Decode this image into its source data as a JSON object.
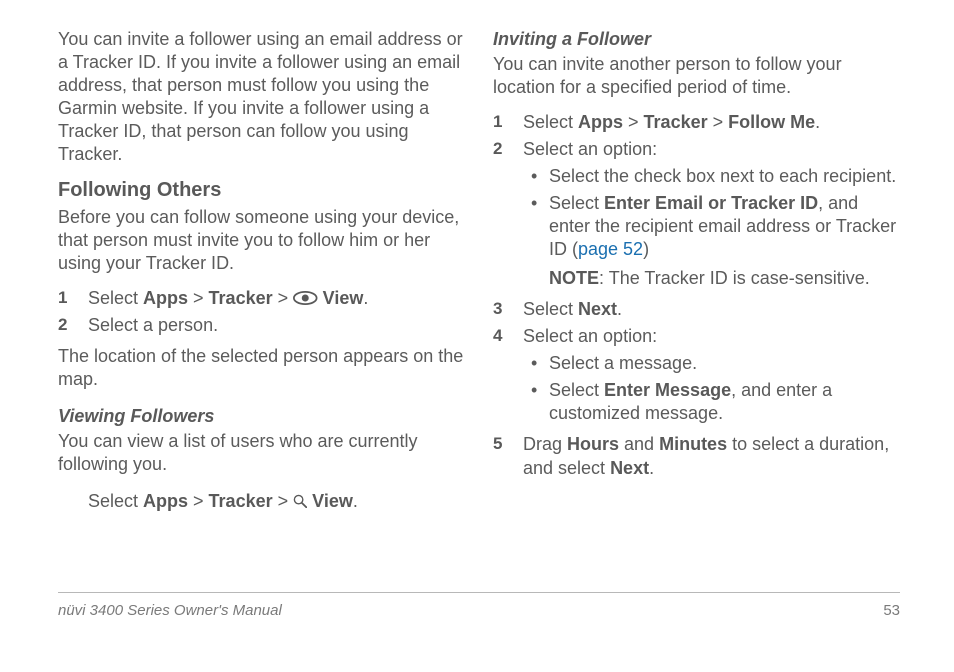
{
  "col1": {
    "intro": "You can invite a follower using an email address or a Tracker ID. If you invite a follower using an email address, that person must follow you using the Garmin website. If you invite a follower using a Tracker ID, that person can follow you using Tracker.",
    "h2": "Following Others",
    "p1": "Before you can follow someone using your device, that person must invite you to follow him or her using your Tracker ID.",
    "step1_a": "Select ",
    "apps": "Apps",
    "gt": " > ",
    "tracker": "Tracker",
    "view": "View",
    "period": ".",
    "step2": "Select a person.",
    "after": "The location of the selected person appears on the map.",
    "h3": "Viewing Followers",
    "p2": "You can view a list of users who are currently following you.",
    "vf_a": "Select "
  },
  "col2": {
    "h3": "Inviting a Follower",
    "intro": "You can invite another person to follow your location for a specified period of time.",
    "s1_a": "Select ",
    "apps": "Apps",
    "gt": " > ",
    "tracker": "Tracker",
    "followme": "Follow Me",
    "period": ".",
    "s2": "Select an option:",
    "b1": "Select the check box next to each recipient.",
    "b2_a": "Select ",
    "b2_b": "Enter Email or Tracker ID",
    "b2_c": ", and enter the recipient email address or Tracker ID (",
    "link": "page 52",
    "b2_d": ")",
    "note_a": "NOTE",
    "note_b": ": The Tracker ID is case-sensitive.",
    "s3_a": "Select ",
    "next": "Next",
    "s4": "Select an option:",
    "b3": "Select a message.",
    "b4_a": "Select ",
    "b4_b": "Enter Message",
    "b4_c": ", and enter a customized message.",
    "s5_a": "Drag ",
    "hours": "Hours",
    "s5_b": " and ",
    "minutes": "Minutes",
    "s5_c": " to select a duration, and select "
  },
  "footer": {
    "left": "nüvi 3400 Series Owner's Manual",
    "right": "53"
  }
}
